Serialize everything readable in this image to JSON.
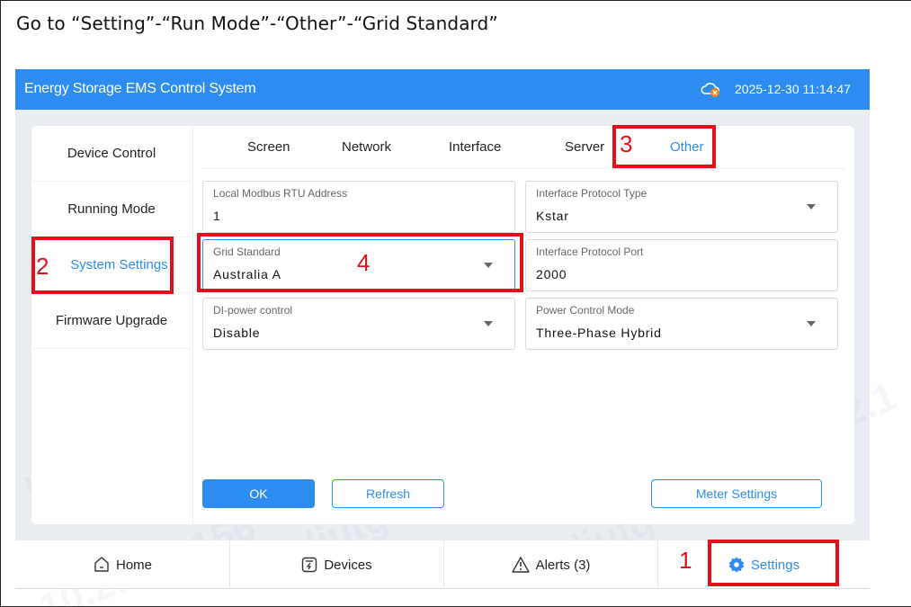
{
  "instruction": "Go to “Setting”-“Run Mode”-“Other”-“Grid Standard”",
  "titlebar": {
    "title": "Energy Storage EMS Control System",
    "datetime": "2025-12-30 11:14:47",
    "cloud_icon": "cloud-error-icon"
  },
  "sidebar": {
    "items": [
      {
        "label": "Device Control"
      },
      {
        "label": "Running Mode"
      },
      {
        "label": "System Settings",
        "active": true
      },
      {
        "label": "Firmware Upgrade"
      }
    ]
  },
  "tabs": [
    {
      "label": "Screen"
    },
    {
      "label": "Network"
    },
    {
      "label": "Interface"
    },
    {
      "label": "Server"
    },
    {
      "label": "Other",
      "active": true
    }
  ],
  "form": {
    "modbus_address": {
      "label": "Local Modbus RTU Address",
      "value": "1"
    },
    "protocol_type": {
      "label": "Interface Protocol Type",
      "value": "Kstar"
    },
    "grid_standard": {
      "label": "Grid Standard",
      "value": "Australia A"
    },
    "protocol_port": {
      "label": "Interface Protocol Port",
      "value": "2000"
    },
    "di_power": {
      "label": "DI-power control",
      "value": "Disable"
    },
    "power_mode": {
      "label": "Power Control Mode",
      "value": "Three-Phase Hybrid"
    }
  },
  "buttons": {
    "ok": "OK",
    "refresh": "Refresh",
    "meter": "Meter Settings"
  },
  "bottomnav": {
    "home": "Home",
    "devices": "Devices",
    "alerts": "Alerts (3)",
    "settings": "Settings"
  },
  "annotations": [
    "1",
    "2",
    "3",
    "4"
  ],
  "watermark": {
    "texts": [
      "liutg",
      "10.2.116.156",
      "10.2.116.156 liutg",
      "10.2.116.156",
      "10.2.1",
      "liutg",
      "156 liutg",
      "56 liutg",
      "10.2.116.156"
    ]
  },
  "colors": {
    "accent": "#2d8cf0",
    "annotation": "#e3101a"
  }
}
